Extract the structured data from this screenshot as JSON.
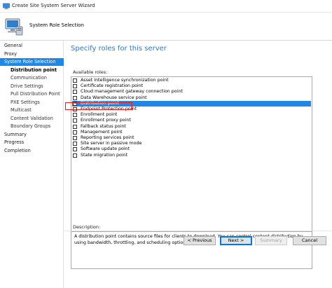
{
  "window": {
    "title": "Create Site System Server Wizard"
  },
  "header": {
    "title": "System Role Selection"
  },
  "nav": {
    "items": [
      {
        "label": "General",
        "level": 0,
        "active": false,
        "bold": false
      },
      {
        "label": "Proxy",
        "level": 0,
        "active": false,
        "bold": false
      },
      {
        "label": "System Role Selection",
        "level": 0,
        "active": true,
        "bold": false
      },
      {
        "label": "Distribution point",
        "level": 1,
        "active": false,
        "bold": true
      },
      {
        "label": "Communication",
        "level": 1,
        "active": false,
        "bold": false
      },
      {
        "label": "Drive Settings",
        "level": 1,
        "active": false,
        "bold": false
      },
      {
        "label": "Pull Distribution Point",
        "level": 1,
        "active": false,
        "bold": false
      },
      {
        "label": "PXE Settings",
        "level": 1,
        "active": false,
        "bold": false
      },
      {
        "label": "Multicast",
        "level": 1,
        "active": false,
        "bold": false
      },
      {
        "label": "Content Validation",
        "level": 1,
        "active": false,
        "bold": false
      },
      {
        "label": "Boundary Groups",
        "level": 1,
        "active": false,
        "bold": false
      },
      {
        "label": "Summary",
        "level": 0,
        "active": false,
        "bold": false
      },
      {
        "label": "Progress",
        "level": 0,
        "active": false,
        "bold": false
      },
      {
        "label": "Completion",
        "level": 0,
        "active": false,
        "bold": false
      }
    ]
  },
  "main": {
    "heading": "Specify roles for this server",
    "roles_label": "Available roles:",
    "roles": [
      {
        "label": "Asset Intelligence synchronization point",
        "checked": false,
        "selected": false
      },
      {
        "label": "Certificate registration point",
        "checked": false,
        "selected": false
      },
      {
        "label": "Cloud management gateway connection point",
        "checked": false,
        "selected": false
      },
      {
        "label": "Data Warehouse service point",
        "checked": false,
        "selected": false
      },
      {
        "label": "Distribution point",
        "checked": true,
        "selected": true
      },
      {
        "label": "Endpoint Protection point",
        "checked": false,
        "selected": false
      },
      {
        "label": "Enrollment point",
        "checked": false,
        "selected": false
      },
      {
        "label": "Enrollment proxy point",
        "checked": false,
        "selected": false
      },
      {
        "label": "Fallback status point",
        "checked": false,
        "selected": false
      },
      {
        "label": "Management point",
        "checked": false,
        "selected": false
      },
      {
        "label": "Reporting services point",
        "checked": false,
        "selected": false
      },
      {
        "label": "Site server in passive mode",
        "checked": false,
        "selected": false
      },
      {
        "label": "Software update point",
        "checked": false,
        "selected": false
      },
      {
        "label": "State migration point",
        "checked": false,
        "selected": false
      }
    ],
    "description_label": "Description:",
    "description_text": "A distribution point contains source files for clients to download. You can control content distribution by using bandwidth, throttling, and scheduling options."
  },
  "buttons": {
    "previous": "< Previous",
    "next": "Next >",
    "summary": "Summary",
    "cancel": "Cancel"
  },
  "colors": {
    "accent": "#1f87e5",
    "heading": "#2f78c3",
    "highlight_box": "#e02020"
  }
}
